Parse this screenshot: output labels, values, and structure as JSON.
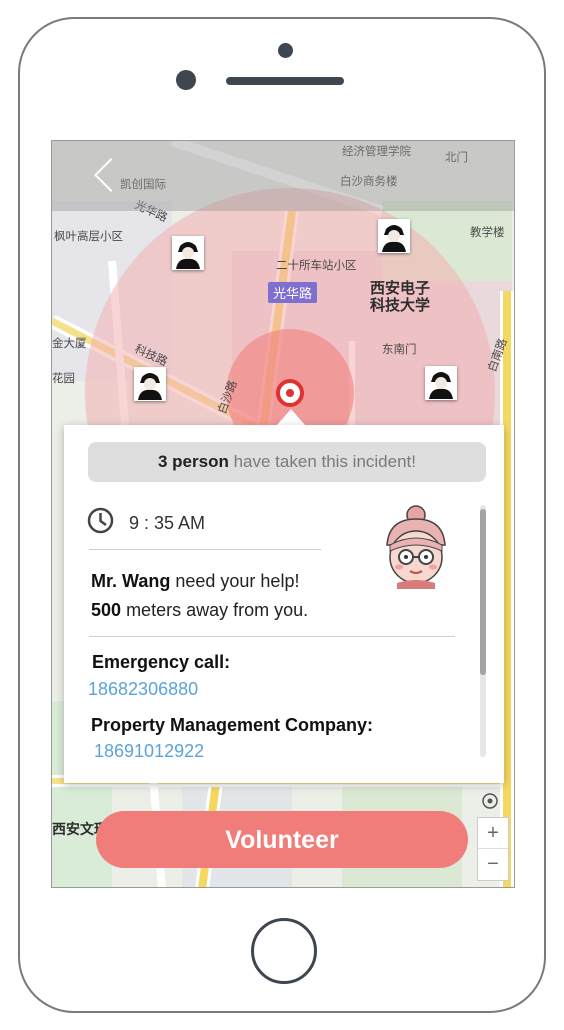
{
  "map": {
    "labels": {
      "jingji": "经济管理学院",
      "beimen": "北门",
      "kaichuang": "凯创国际",
      "baisha": "白沙商务楼",
      "guanghua_road": "光华路",
      "fengye": "枫叶高层小区",
      "jiaoxuelou": "教学楼",
      "ershi": "二十所车站小区",
      "guanghua_tag": "光华路",
      "university": "西安电子\n科技大学",
      "dongnanmen": "东南门",
      "jindasha": "金大厦",
      "keji_road": "科技路",
      "gongyuan": "花园",
      "baisha_road": "白沙路",
      "baiyan_road": "白南路",
      "xian_wen": "西安文理"
    },
    "colors": {
      "radius_outer": "#f2b1b1",
      "radius_inner": "#f27e7e",
      "target": "#e03030"
    }
  },
  "incident": {
    "count": "3 person",
    "banner_rest": "have taken this incident!",
    "time": "9 : 35 AM",
    "name": "Mr. Wang",
    "help_text": "need your help!",
    "distance": "500",
    "distance_text": "meters away from you.",
    "emergency_label": "Emergency call:",
    "emergency_phone": "18682306880",
    "property_label": "Property Management Company:",
    "property_phone": "18691012922"
  },
  "controls": {
    "zoom_in": "+",
    "zoom_out": "−"
  },
  "action": {
    "volunteer_label": "Volunteer",
    "color": "#f07d7a"
  }
}
